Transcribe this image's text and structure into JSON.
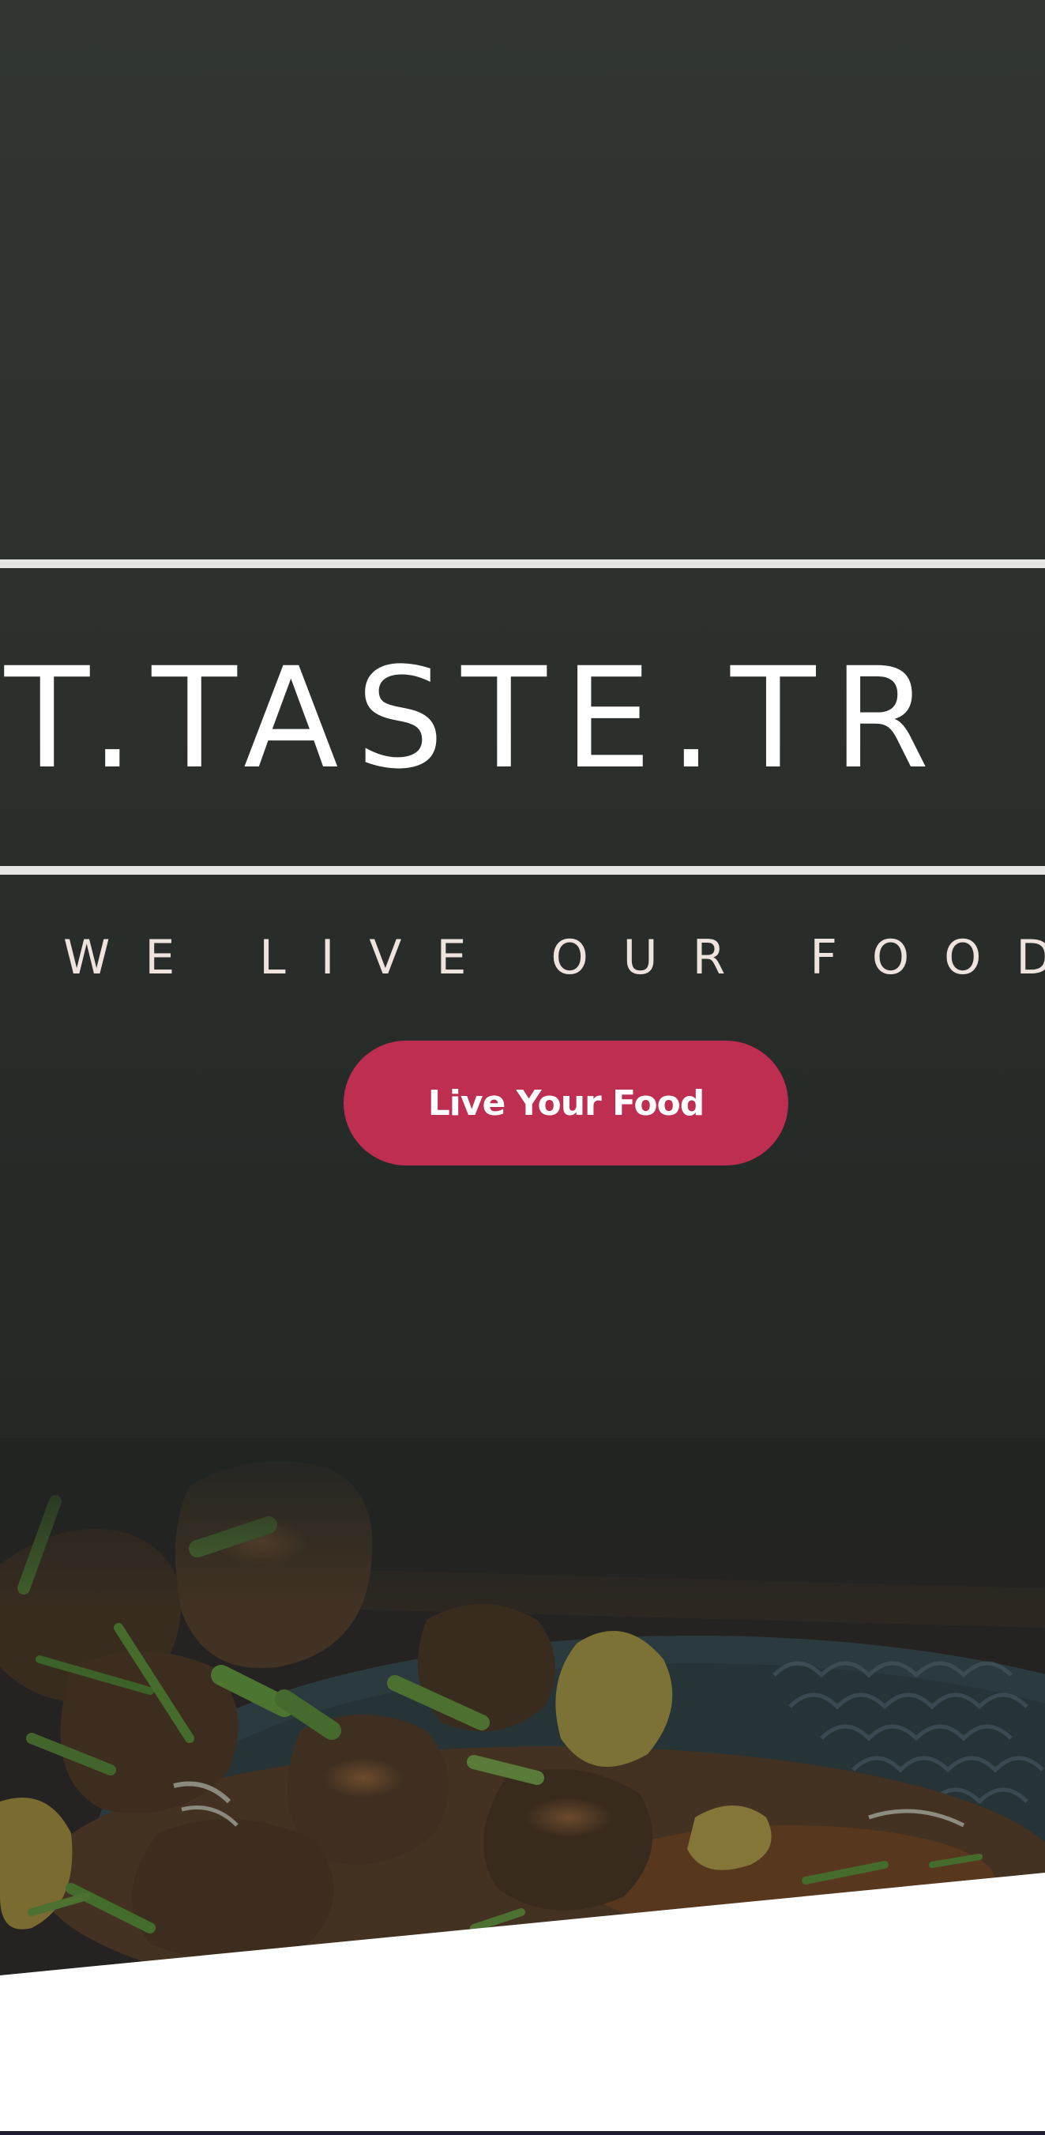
{
  "hero": {
    "headline": "AT.TASTE.TR",
    "tagline": "WE LIVE OUR FOOD",
    "cta_label": "Live Your Food"
  },
  "colors": {
    "background": "#2c302c",
    "accent": "#bd2e50",
    "rule": "#e6e6e3",
    "text": "#ffffff"
  }
}
